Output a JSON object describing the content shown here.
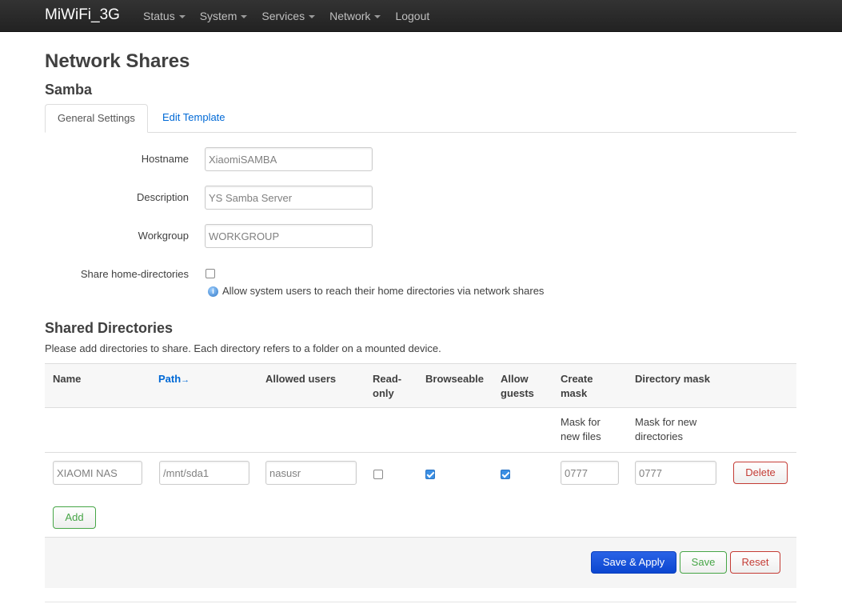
{
  "navbar": {
    "brand": "MiWiFi_3G",
    "menu": [
      {
        "label": "Status",
        "has_dropdown": true
      },
      {
        "label": "System",
        "has_dropdown": true
      },
      {
        "label": "Services",
        "has_dropdown": true
      },
      {
        "label": "Network",
        "has_dropdown": true
      },
      {
        "label": "Logout",
        "has_dropdown": false
      }
    ]
  },
  "page": {
    "title": "Network Shares",
    "section": "Samba"
  },
  "tabs": [
    {
      "label": "General Settings",
      "active": true
    },
    {
      "label": "Edit Template",
      "active": false
    }
  ],
  "general": {
    "hostname_label": "Hostname",
    "hostname_value": "XiaomiSAMBA",
    "description_label": "Description",
    "description_value": "YS Samba Server",
    "workgroup_label": "Workgroup",
    "workgroup_value": "WORKGROUP",
    "share_home_label": "Share home-directories",
    "share_home_checked": false,
    "share_home_help": "Allow system users to reach their home directories via network shares",
    "help_icon": "info-icon"
  },
  "shared": {
    "title": "Shared Directories",
    "description": "Please add directories to share. Each directory refers to a folder on a mounted device.",
    "columns": {
      "name": "Name",
      "path": "Path",
      "path_sort_arrow": "→",
      "allowed_users": "Allowed users",
      "read_only_1": "Read-",
      "read_only_2": "only",
      "browseable": "Browseable",
      "allow_guests_1": "Allow",
      "allow_guests_2": "guests",
      "create_mask_1": "Create",
      "create_mask_2": "mask",
      "directory_mask": "Directory mask"
    },
    "subheaders": {
      "create_mask_1": "Mask for",
      "create_mask_2": "new files",
      "directory_mask_1": "Mask for new",
      "directory_mask_2": "directories"
    },
    "rows": [
      {
        "name": "XIAOMI NAS",
        "path": "/mnt/sda1",
        "allowed_users": "nasusr",
        "read_only": false,
        "browseable": true,
        "allow_guests": true,
        "create_mask": "0777",
        "directory_mask": "0777",
        "delete_label": "Delete"
      }
    ],
    "add_label": "Add"
  },
  "actions": {
    "save_apply": "Save & Apply",
    "save": "Save",
    "reset": "Reset"
  },
  "colors": {
    "navbar_bg": "#222222",
    "link": "#0069d6",
    "primary": "#0b46d0",
    "success": "#46a546",
    "danger": "#c43c35"
  }
}
